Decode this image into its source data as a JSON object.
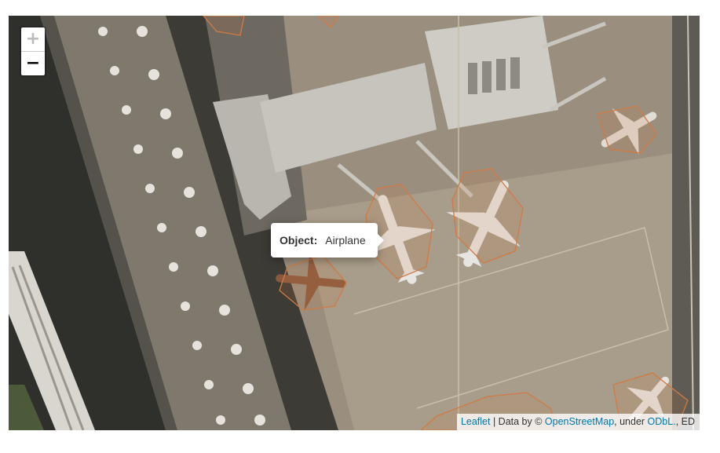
{
  "zoom": {
    "in_label": "+",
    "out_label": "−"
  },
  "popup": {
    "key": "Object:",
    "value": "Airplane"
  },
  "attribution": {
    "leaflet": "Leaflet",
    "sep": " | Data by © ",
    "osm": "OpenStreetMap",
    "under": ", under ",
    "odbl": "ODbL.",
    "tail": ", ED"
  },
  "colors": {
    "annotation_outline": "#d07a45",
    "link": "#0078a8"
  }
}
